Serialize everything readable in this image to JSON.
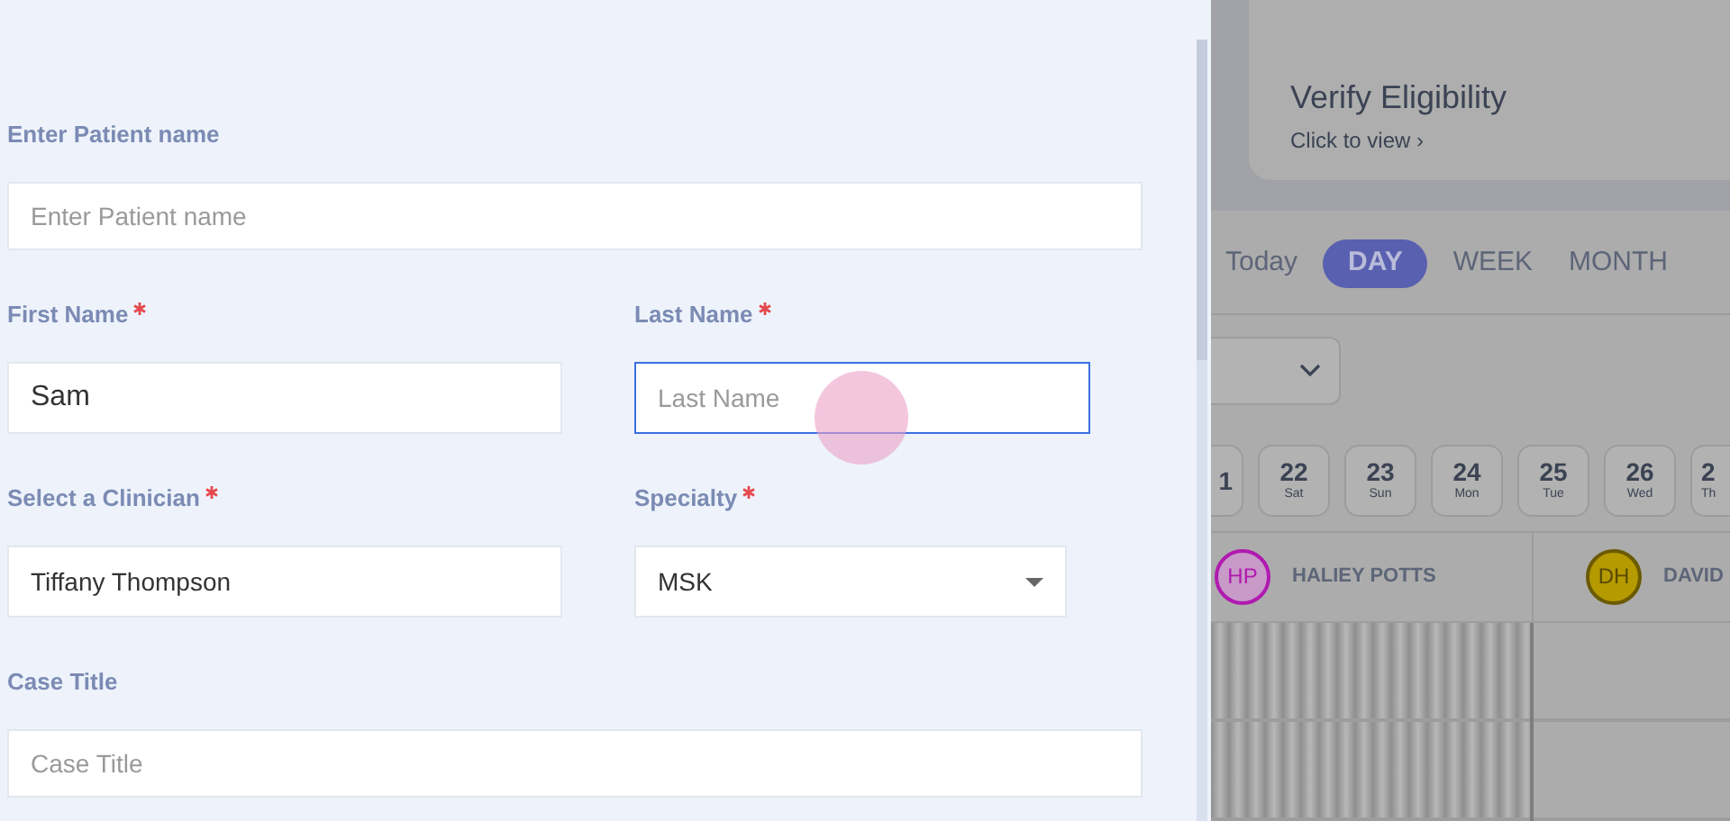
{
  "form": {
    "rows": [
      {
        "fields": [
          {
            "label": "Enter Patient name",
            "required": false,
            "kind": "text",
            "placeholder": "Enter Patient name",
            "focused": false
          }
        ]
      },
      {
        "fields": [
          {
            "label": "First Name",
            "required": true,
            "kind": "text",
            "value": "Sam",
            "focused": false
          },
          {
            "label": "Last Name",
            "required": true,
            "kind": "text",
            "placeholder": "Last Name",
            "focused": true
          }
        ]
      },
      {
        "fields": [
          {
            "label": "Select a Clinician",
            "required": true,
            "kind": "text",
            "value": "Tiffany Thompson",
            "focused": false
          },
          {
            "label": "Specialty",
            "required": true,
            "kind": "select",
            "value": "MSK",
            "focused": false
          }
        ]
      },
      {
        "fields": [
          {
            "label": "Case Title",
            "required": false,
            "kind": "text",
            "placeholder": "Case Title",
            "focused": false
          }
        ]
      }
    ]
  },
  "background": {
    "eligibility_card": {
      "title": "Verify Eligibility",
      "link": "Click to view ›"
    },
    "view_tabs": [
      {
        "label": "Today",
        "selected": false
      },
      {
        "label": "DAY",
        "selected": true
      },
      {
        "label": "WEEK",
        "selected": false
      },
      {
        "label": "MONTH",
        "selected": false
      }
    ],
    "dates": [
      {
        "day": "1"
      },
      {
        "day": "22",
        "weekday": "Sat"
      },
      {
        "day": "23",
        "weekday": "Sun"
      },
      {
        "day": "24",
        "weekday": "Mon"
      },
      {
        "day": "25",
        "weekday": "Tue"
      },
      {
        "day": "26",
        "weekday": "Wed"
      },
      {
        "day": "2",
        "weekday": "Th"
      }
    ],
    "clinicians": [
      {
        "initials": "HP",
        "name": "HALIEY POTTS",
        "color": "#b01ab0"
      },
      {
        "initials": "DH",
        "name": "DAVID",
        "color": "#b59a00"
      }
    ]
  }
}
